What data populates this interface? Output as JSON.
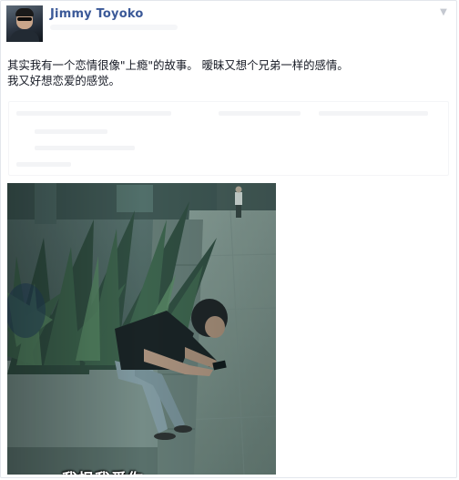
{
  "post": {
    "author": "Jimmy Toyoko",
    "text_lines": [
      "其实我有一个恋情很像\"上瘾\"的故事。 暧昧又想个兄弟一样的感情。",
      "我又好想恋爱的感觉。"
    ],
    "photo_caption": "我恨我爱你"
  },
  "icons": {
    "options": "chevron-down-icon"
  },
  "colors": {
    "author_link": "#3b5998",
    "body_text": "#141823",
    "card_border": "#e3e6ec"
  }
}
